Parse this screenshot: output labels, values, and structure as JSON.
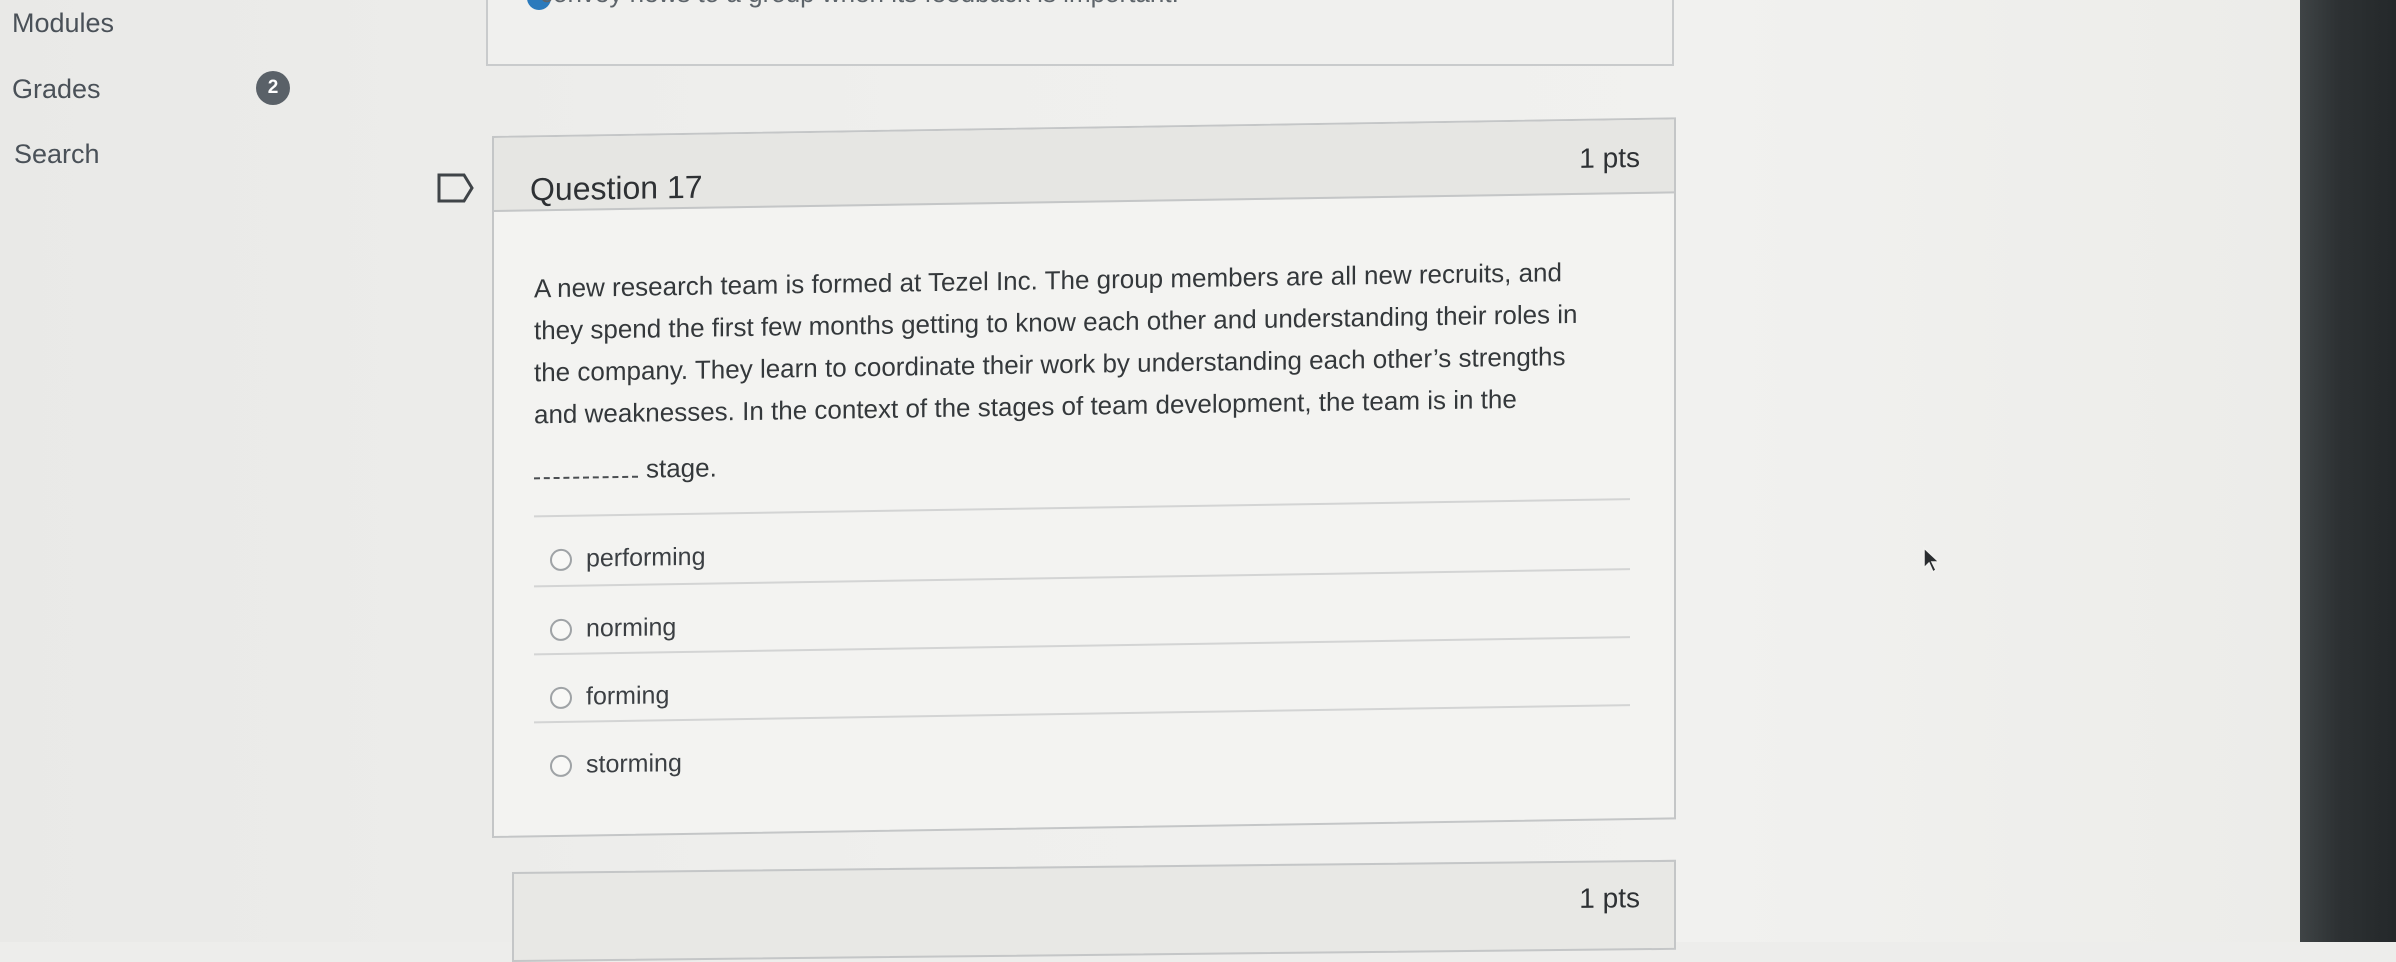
{
  "sidebar": {
    "items": [
      {
        "label": "Modules"
      },
      {
        "label": "Grades",
        "badge": "2"
      },
      {
        "label": "Search"
      }
    ]
  },
  "previous_question": {
    "partial_text": "convey news to a group when its feedback is important."
  },
  "question": {
    "title": "Question 17",
    "points": "1 pts",
    "text_lines": [
      "A new research team is formed at Tezel Inc. The group members are all new recruits, and",
      "they spend the first few months getting to know each other and understanding their roles in",
      "the company. They learn to coordinate their work by understanding each other’s strengths",
      "and weaknesses. In the context of the stages of team development, the team is in the"
    ],
    "blank_suffix": "stage.",
    "answers": [
      {
        "label": "performing",
        "selected": false
      },
      {
        "label": "norming",
        "selected": false
      },
      {
        "label": "forming",
        "selected": false
      },
      {
        "label": "storming",
        "selected": false
      }
    ]
  },
  "next_question": {
    "points": "1 pts"
  },
  "icons": {
    "flag": "flag-icon",
    "check": "check-circle-icon",
    "cursor": "mouse-pointer-icon"
  },
  "colors": {
    "badge": "#5a6168",
    "check": "#2b7abc"
  }
}
